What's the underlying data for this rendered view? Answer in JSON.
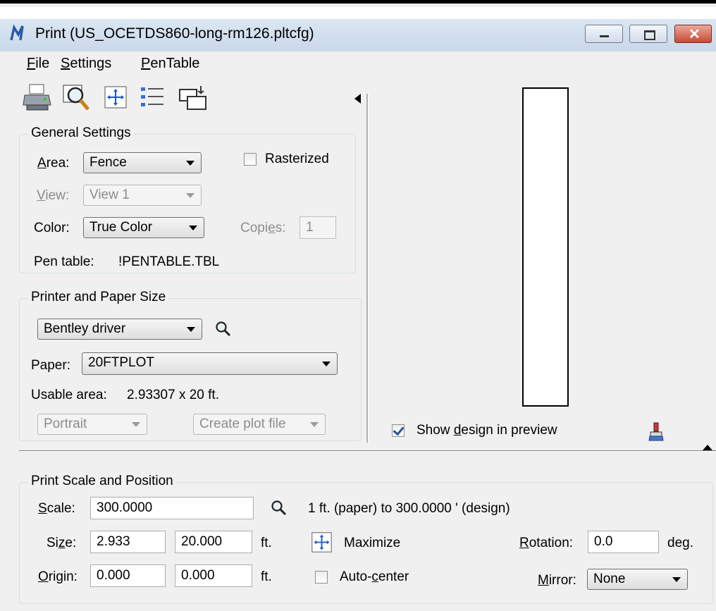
{
  "window": {
    "title": "Print  (US_OCETDS860-long-rm126.pltcfg)"
  },
  "menu": [
    {
      "label": "File",
      "u": "F",
      "rest": "ile"
    },
    {
      "label": "Settings",
      "u": "S",
      "rest": "ettings"
    },
    {
      "label": "PenTable",
      "u": "P",
      "rest": "enTable"
    }
  ],
  "toolbar": {
    "icons": [
      "printer-icon",
      "preview-magnifier-icon",
      "maximize-icon",
      "list-icon",
      "page-setup-icon"
    ]
  },
  "general": {
    "legend": "General Settings",
    "area_label_u": "A",
    "area_label_rest": "rea:",
    "area_value": "Fence",
    "rasterized_label": "Rasterized",
    "view_label_u": "V",
    "view_label_rest": "iew:",
    "view_value": "View 1",
    "color_label": "Color:",
    "color_value": "True Color",
    "copies_label_a": "Copi",
    "copies_label_u": "e",
    "copies_label_b": "s:",
    "copies_value": "1",
    "pentable_label": "Pen table:",
    "pentable_value": "!PENTABLE.TBL"
  },
  "printer": {
    "legend": "Printer and Paper Size",
    "driver_value": "Bentley driver",
    "paper_label": "Paper:",
    "paper_value": "20FTPLOT",
    "usable_label": "Usable area:",
    "usable_value": "2.93307 x 20 ft.",
    "orientation_value": "Portrait",
    "output_value": "Create plot file"
  },
  "preview": {
    "show_label_a": "Show ",
    "show_label_u": "d",
    "show_label_b": "esign in preview",
    "show_checked": true
  },
  "scale": {
    "legend": "Print Scale and Position",
    "scale_label_u": "S",
    "scale_label_rest": "cale:",
    "scale_value": "300.0000",
    "scale_desc": "1 ft. (paper) to 300.0000 ' (design)",
    "size_label_a": "Si",
    "size_label_u": "z",
    "size_label_b": "e:",
    "size_x": "2.933",
    "size_y": "20.000",
    "size_unit": "ft.",
    "maximize_label": "Maximize",
    "rotation_label_u": "R",
    "rotation_label_rest": "otation:",
    "rotation_value": "0.0",
    "rotation_unit": "deg.",
    "origin_label_u": "O",
    "origin_label_rest": "rigin:",
    "origin_x": "0.000",
    "origin_y": "0.000",
    "origin_unit": "ft.",
    "autocenter_a": "Auto-",
    "autocenter_u": "c",
    "autocenter_b": "enter",
    "mirror_label_u": "M",
    "mirror_label_rest": "irror:",
    "mirror_value": "None"
  }
}
